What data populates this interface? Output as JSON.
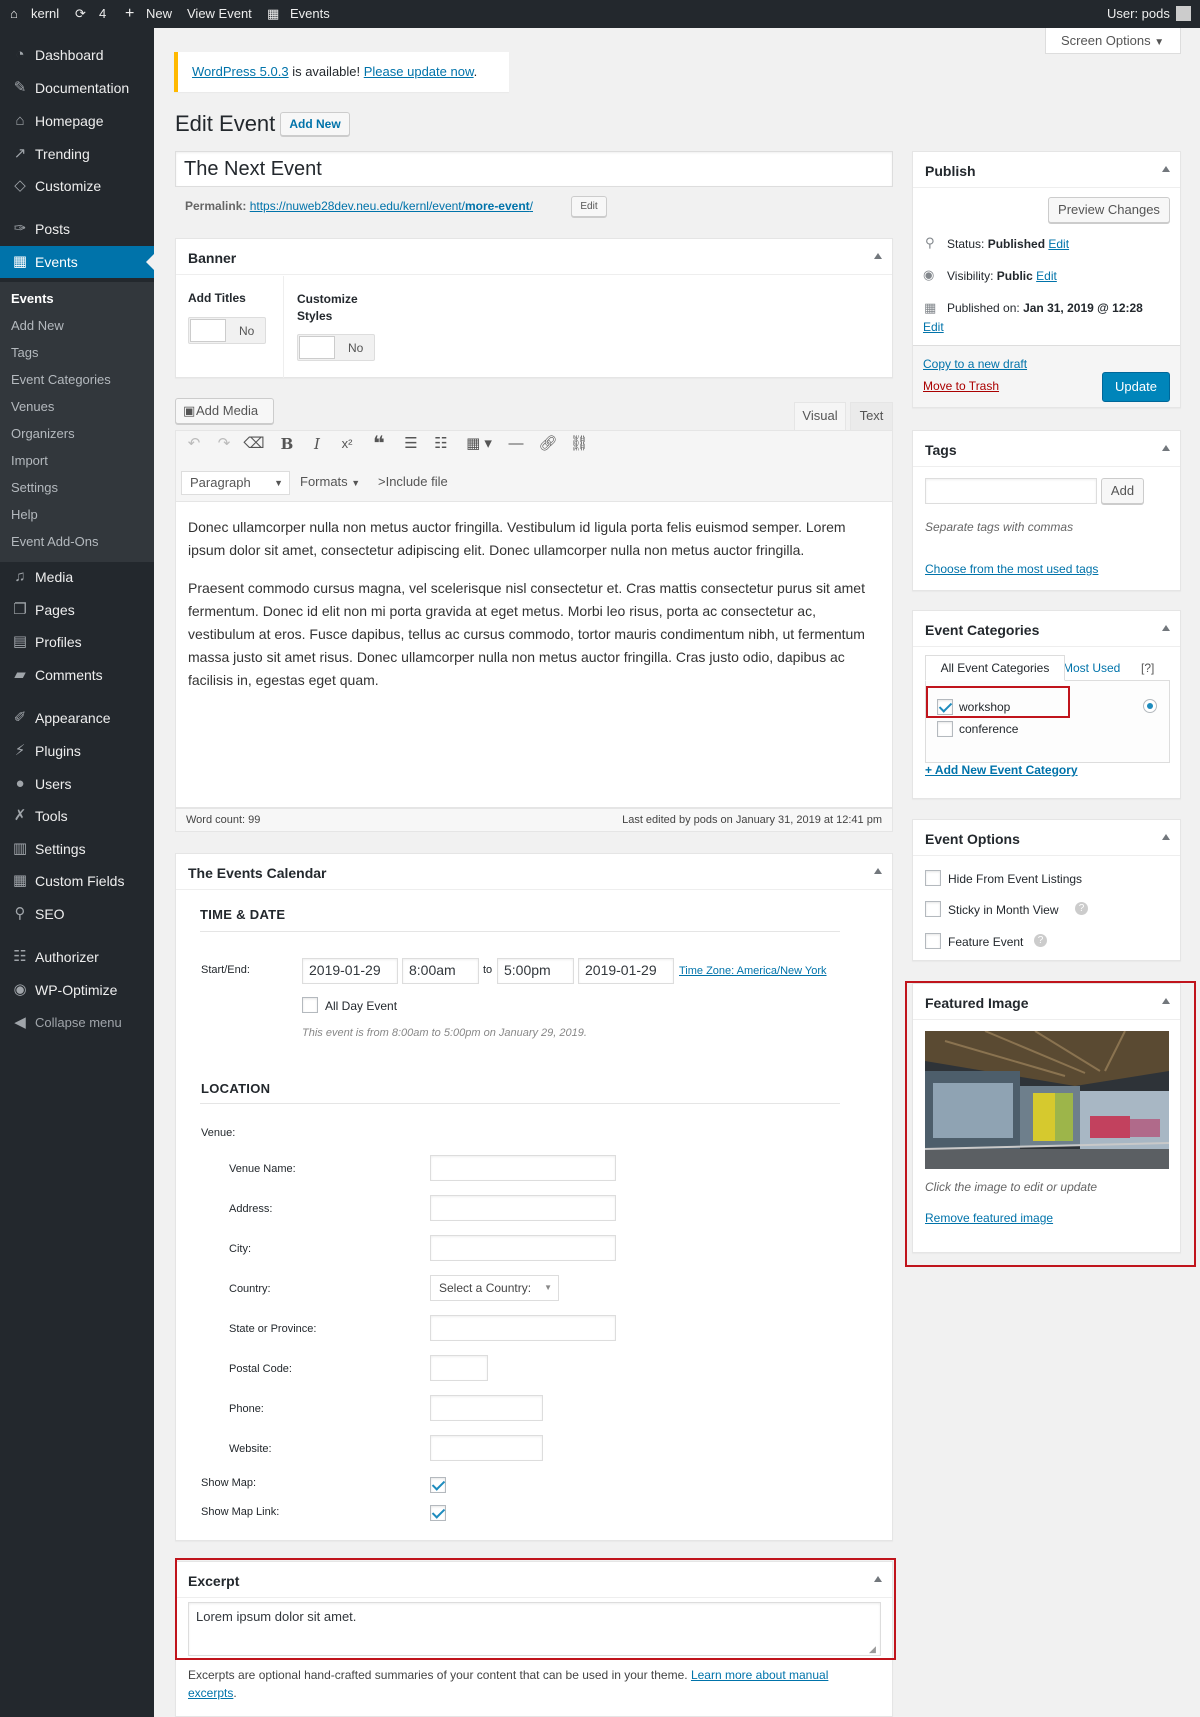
{
  "adminbar": {
    "site": "kernl",
    "updates": "4",
    "new": "New",
    "view": "View Event",
    "events": "Events",
    "user": "User: pods"
  },
  "sidebar": {
    "items": [
      "Dashboard",
      "Documentation",
      "Homepage",
      "Trending",
      "Customize",
      "Posts",
      "Events",
      "Media",
      "Pages",
      "Profiles",
      "Comments",
      "Appearance",
      "Plugins",
      "Users",
      "Tools",
      "Settings",
      "Custom Fields",
      "SEO",
      "Authorizer",
      "WP-Optimize",
      "Collapse menu"
    ],
    "submenu": [
      "Events",
      "Add New",
      "Tags",
      "Event Categories",
      "Venues",
      "Organizers",
      "Import",
      "Settings",
      "Help",
      "Event Add-Ons"
    ]
  },
  "screen_options": "Screen Options",
  "notice": {
    "link1": "WordPress 5.0.3",
    "mid": " is available! ",
    "link2": "Please update now",
    "end": "."
  },
  "heading": {
    "title": "Edit Event",
    "add_new": "Add New"
  },
  "post_title": "The Next Event",
  "permalink": {
    "label": "Permalink:",
    "url_base": "https://nuweb28dev.neu.edu/kernl/event/",
    "slug": "more-event",
    "url_end": "/",
    "edit": "Edit"
  },
  "banner": {
    "title": "Banner",
    "add_titles": "Add Titles",
    "add_titles_value": "No",
    "customize_styles": "Customize Styles",
    "customize_value": "No"
  },
  "editor": {
    "add_media": "Add Media",
    "tab_visual": "Visual",
    "tab_text": "Text",
    "format": "Paragraph",
    "formats": "Formats",
    "include_file": ">Include file",
    "p1": "Donec ullamcorper nulla non metus auctor fringilla. Vestibulum id ligula porta felis euismod semper. Lorem ipsum dolor sit amet, consectetur adipiscing elit. Donec ullamcorper nulla non metus auctor fringilla.",
    "p2": "Praesent commodo cursus magna, vel scelerisque nisl consectetur et. Cras mattis consectetur purus sit amet fermentum. Donec id elit non mi porta gravida at eget metus. Morbi leo risus, porta ac consectetur ac, vestibulum at eros. Fusce dapibus, tellus ac cursus commodo, tortor mauris condimentum nibh, ut fermentum massa justo sit amet risus. Donec ullamcorper nulla non metus auctor fringilla. Cras justo odio, dapibus ac facilisis in, egestas eget quam.",
    "word_count": "Word count: 99",
    "last_edited": "Last edited by pods on January 31, 2019 at 12:41 pm"
  },
  "calendar": {
    "title": "The Events Calendar",
    "time_date": "TIME & DATE",
    "start_end": "Start/End:",
    "start_date": "2019-01-29",
    "start_time": "8:00am",
    "to": "to",
    "end_time": "5:00pm",
    "end_date": "2019-01-29",
    "timezone": "Time Zone: America/New York",
    "all_day": "All Day Event",
    "summary": "This event is from 8:00am to 5:00pm on January 29, 2019.",
    "location": "LOCATION",
    "venue": "Venue:",
    "fields": [
      "Venue Name:",
      "Address:",
      "City:",
      "Country:",
      "State or Province:",
      "Postal Code:",
      "Phone:",
      "Website:"
    ],
    "country_placeholder": "Select a Country:",
    "show_map": "Show Map:",
    "show_map_link": "Show Map Link:"
  },
  "excerpt": {
    "title": "Excerpt",
    "value": "Lorem ipsum dolor sit amet.",
    "help": "Excerpts are optional hand-crafted summaries of your content that can be used in your theme. ",
    "learn": "Learn more about manual excerpts",
    "end": "."
  },
  "publish": {
    "title": "Publish",
    "preview": "Preview Changes",
    "status_label": "Status: ",
    "status": "Published",
    "visibility_label": "Visibility: ",
    "visibility": "Public",
    "published_label": "Published on: ",
    "published": "Jan 31, 2019 @ 12:28",
    "edit": "Edit",
    "copy": "Copy to a new draft",
    "trash": "Move to Trash",
    "update": "Update"
  },
  "tags": {
    "title": "Tags",
    "add": "Add",
    "hint": "Separate tags with commas",
    "choose": "Choose from the most used tags"
  },
  "categories": {
    "title": "Event Categories",
    "tab_all": "All Event Categories",
    "tab_used": "Most Used",
    "help": "[?]",
    "items": [
      "workshop",
      "conference"
    ],
    "add_new": "+ Add New Event Category"
  },
  "options": {
    "title": "Event Options",
    "items": [
      "Hide From Event Listings",
      "Sticky in Month View",
      "Feature Event"
    ]
  },
  "featured": {
    "title": "Featured Image",
    "caption": "Click the image to edit or update",
    "remove": "Remove featured image"
  },
  "colors": {
    "primary": "#0073aa",
    "sidebar": "#23282d",
    "highlight": "#c0141c"
  }
}
